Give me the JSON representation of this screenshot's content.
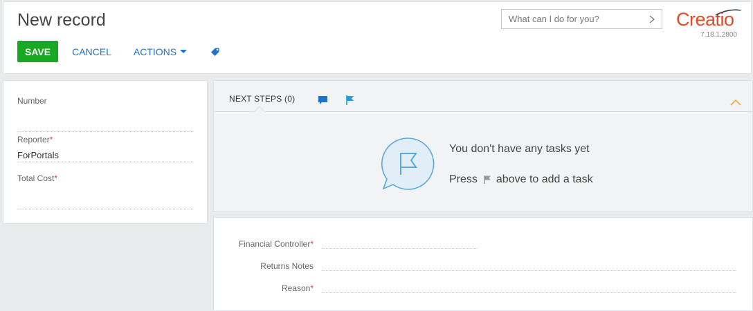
{
  "header": {
    "title": "New record",
    "save_label": "SAVE",
    "cancel_label": "CANCEL",
    "actions_label": "ACTIONS",
    "search_placeholder": "What can I do for you?",
    "logo_text": "Creatio",
    "version": "7.18.1.2800"
  },
  "left_panel": {
    "fields": [
      {
        "label": "Number",
        "required": "",
        "value": ""
      },
      {
        "label": "Reporter",
        "required": "*",
        "value": "ForPortals"
      },
      {
        "label": "Total Cost",
        "required": "*",
        "value": ""
      }
    ]
  },
  "next_steps": {
    "tab_label": "NEXT STEPS (0)",
    "empty_title": "You don't have any tasks yet",
    "empty_press": "Press",
    "empty_suffix": "above to add a task"
  },
  "bottom_panel": {
    "fields": [
      {
        "label": "Financial Controller",
        "required": "*",
        "value": ""
      },
      {
        "label": "Returns Notes",
        "required": "",
        "value": ""
      },
      {
        "label": "Reason",
        "required": "*",
        "value": ""
      }
    ]
  },
  "colors": {
    "save_green": "#18a824",
    "link_blue": "#1f73c8",
    "brand_orange": "#e24a28",
    "required_red": "#e03b3b",
    "flag_blue": "#1aa0e8"
  },
  "icons": [
    "tag-icon",
    "chevron-right-icon",
    "chat-icon",
    "flag-icon",
    "chevron-up-icon",
    "flag-bubble-icon",
    "mini-flag-icon"
  ]
}
